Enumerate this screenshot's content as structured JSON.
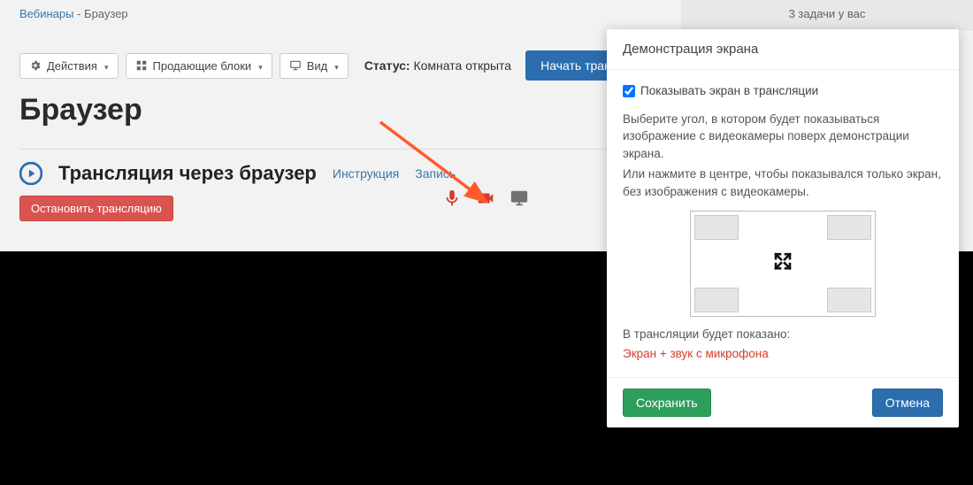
{
  "breadcrumb": {
    "parent": "Вебинары",
    "sep": " - ",
    "current": "Браузер"
  },
  "topstatus": {
    "line": "3 задачи у вас"
  },
  "toolbar": {
    "actions": "Действия",
    "blocks": "Продающие блоки",
    "view": "Вид",
    "status_label": "Статус:",
    "status_value": "Комната открыта",
    "start_broadcast": "Начать трансляцию"
  },
  "page": {
    "title": "Браузер"
  },
  "broadcast": {
    "title": "Трансляция через браузер",
    "instruction_link": "Инструкция",
    "record_link": "Запись",
    "stop_btn": "Остановить трансляцию"
  },
  "dialog": {
    "title": "Демонстрация экрана",
    "checkbox_label": "Показывать экран в трансляции",
    "desc1": "Выберите угол, в котором будет показываться изображение с видеокамеры поверх демонстрации экрана.",
    "desc2": "Или нажмите в центре, чтобы показывался только экран, без изображения с видеокамеры.",
    "shown_label": "В трансляции будет показано:",
    "shown_value": "Экран + звук с микрофона",
    "save": "Сохранить",
    "cancel": "Отмена"
  }
}
